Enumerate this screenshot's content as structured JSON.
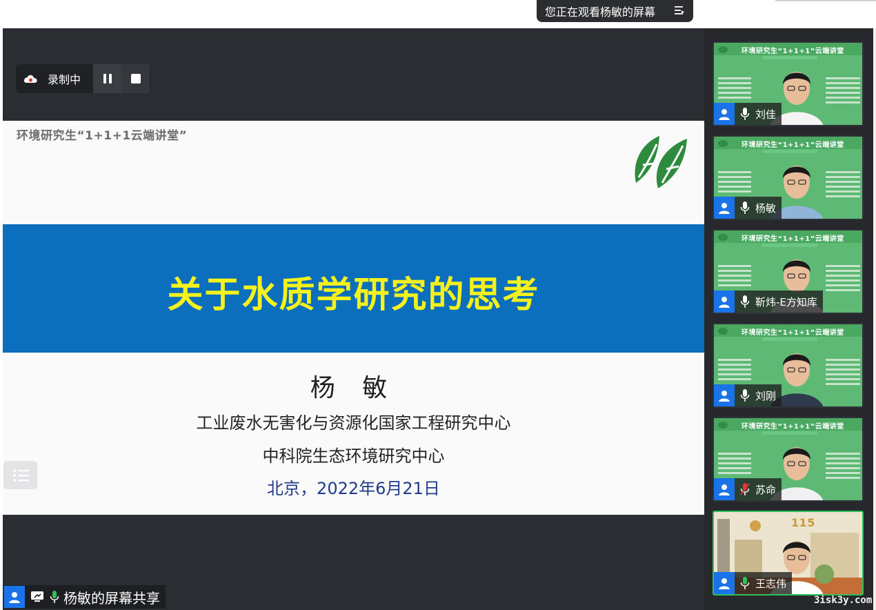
{
  "top_banner": {
    "viewing_text": "您正在观看杨敏的屏幕",
    "menu_icon": "menu-lines-icon"
  },
  "recording": {
    "label": "录制中",
    "cloud_icon": "cloud-recording-icon",
    "pause_icon": "pause-icon",
    "stop_icon": "stop-icon"
  },
  "slide": {
    "header": "环境研究生“1+1+1云端讲堂”",
    "title": "关于水质学研究的思考",
    "speaker": "杨 敏",
    "affiliation_1": "工业废水无害化与资源化国家工程研究中心",
    "affiliation_2": "中科院生态环境研究中心",
    "date": "北京，2022年6月21日",
    "logo_icon": "green-leaf-logo-icon",
    "band_color": "#0b6fbe",
    "title_color": "#f5f11d"
  },
  "share_caption": {
    "label": "杨敏的屏幕共享"
  },
  "participants": [
    {
      "name": "刘佳",
      "tile_title": "环境研究生“1+1+1”云端讲堂",
      "muted": false
    },
    {
      "name": "杨敏",
      "tile_title": "环境研究生“1+1+1”云端讲堂",
      "muted": false
    },
    {
      "name": "靳炜-E方知库",
      "tile_title": "环境研究生“1+1+1”云端讲堂",
      "muted": false
    },
    {
      "name": "刘刚",
      "tile_title": "环境研究生“1+1+1”云端讲堂",
      "muted": false
    },
    {
      "name": "苏命",
      "tile_title": "环境研究生“1+1+1”云端讲堂",
      "muted": true
    },
    {
      "name": "王志伟",
      "tile_title": "115",
      "muted": false,
      "speaking": true
    }
  ],
  "watermark": "3isk3y.com"
}
